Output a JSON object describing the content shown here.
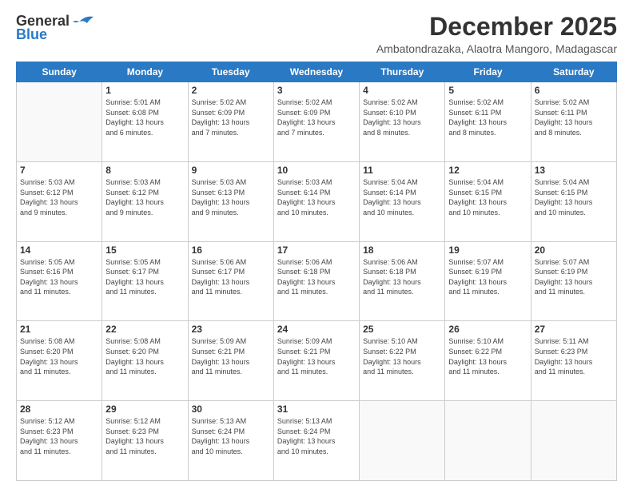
{
  "header": {
    "logo_general": "General",
    "logo_blue": "Blue",
    "month_title": "December 2025",
    "location": "Ambatondrazaka, Alaotra Mangoro, Madagascar"
  },
  "weekdays": [
    "Sunday",
    "Monday",
    "Tuesday",
    "Wednesday",
    "Thursday",
    "Friday",
    "Saturday"
  ],
  "weeks": [
    [
      {
        "day": "",
        "info": ""
      },
      {
        "day": "1",
        "info": "Sunrise: 5:01 AM\nSunset: 6:08 PM\nDaylight: 13 hours\nand 6 minutes."
      },
      {
        "day": "2",
        "info": "Sunrise: 5:02 AM\nSunset: 6:09 PM\nDaylight: 13 hours\nand 7 minutes."
      },
      {
        "day": "3",
        "info": "Sunrise: 5:02 AM\nSunset: 6:09 PM\nDaylight: 13 hours\nand 7 minutes."
      },
      {
        "day": "4",
        "info": "Sunrise: 5:02 AM\nSunset: 6:10 PM\nDaylight: 13 hours\nand 8 minutes."
      },
      {
        "day": "5",
        "info": "Sunrise: 5:02 AM\nSunset: 6:11 PM\nDaylight: 13 hours\nand 8 minutes."
      },
      {
        "day": "6",
        "info": "Sunrise: 5:02 AM\nSunset: 6:11 PM\nDaylight: 13 hours\nand 8 minutes."
      }
    ],
    [
      {
        "day": "7",
        "info": "Sunrise: 5:03 AM\nSunset: 6:12 PM\nDaylight: 13 hours\nand 9 minutes."
      },
      {
        "day": "8",
        "info": "Sunrise: 5:03 AM\nSunset: 6:12 PM\nDaylight: 13 hours\nand 9 minutes."
      },
      {
        "day": "9",
        "info": "Sunrise: 5:03 AM\nSunset: 6:13 PM\nDaylight: 13 hours\nand 9 minutes."
      },
      {
        "day": "10",
        "info": "Sunrise: 5:03 AM\nSunset: 6:14 PM\nDaylight: 13 hours\nand 10 minutes."
      },
      {
        "day": "11",
        "info": "Sunrise: 5:04 AM\nSunset: 6:14 PM\nDaylight: 13 hours\nand 10 minutes."
      },
      {
        "day": "12",
        "info": "Sunrise: 5:04 AM\nSunset: 6:15 PM\nDaylight: 13 hours\nand 10 minutes."
      },
      {
        "day": "13",
        "info": "Sunrise: 5:04 AM\nSunset: 6:15 PM\nDaylight: 13 hours\nand 10 minutes."
      }
    ],
    [
      {
        "day": "14",
        "info": "Sunrise: 5:05 AM\nSunset: 6:16 PM\nDaylight: 13 hours\nand 11 minutes."
      },
      {
        "day": "15",
        "info": "Sunrise: 5:05 AM\nSunset: 6:17 PM\nDaylight: 13 hours\nand 11 minutes."
      },
      {
        "day": "16",
        "info": "Sunrise: 5:06 AM\nSunset: 6:17 PM\nDaylight: 13 hours\nand 11 minutes."
      },
      {
        "day": "17",
        "info": "Sunrise: 5:06 AM\nSunset: 6:18 PM\nDaylight: 13 hours\nand 11 minutes."
      },
      {
        "day": "18",
        "info": "Sunrise: 5:06 AM\nSunset: 6:18 PM\nDaylight: 13 hours\nand 11 minutes."
      },
      {
        "day": "19",
        "info": "Sunrise: 5:07 AM\nSunset: 6:19 PM\nDaylight: 13 hours\nand 11 minutes."
      },
      {
        "day": "20",
        "info": "Sunrise: 5:07 AM\nSunset: 6:19 PM\nDaylight: 13 hours\nand 11 minutes."
      }
    ],
    [
      {
        "day": "21",
        "info": "Sunrise: 5:08 AM\nSunset: 6:20 PM\nDaylight: 13 hours\nand 11 minutes."
      },
      {
        "day": "22",
        "info": "Sunrise: 5:08 AM\nSunset: 6:20 PM\nDaylight: 13 hours\nand 11 minutes."
      },
      {
        "day": "23",
        "info": "Sunrise: 5:09 AM\nSunset: 6:21 PM\nDaylight: 13 hours\nand 11 minutes."
      },
      {
        "day": "24",
        "info": "Sunrise: 5:09 AM\nSunset: 6:21 PM\nDaylight: 13 hours\nand 11 minutes."
      },
      {
        "day": "25",
        "info": "Sunrise: 5:10 AM\nSunset: 6:22 PM\nDaylight: 13 hours\nand 11 minutes."
      },
      {
        "day": "26",
        "info": "Sunrise: 5:10 AM\nSunset: 6:22 PM\nDaylight: 13 hours\nand 11 minutes."
      },
      {
        "day": "27",
        "info": "Sunrise: 5:11 AM\nSunset: 6:23 PM\nDaylight: 13 hours\nand 11 minutes."
      }
    ],
    [
      {
        "day": "28",
        "info": "Sunrise: 5:12 AM\nSunset: 6:23 PM\nDaylight: 13 hours\nand 11 minutes."
      },
      {
        "day": "29",
        "info": "Sunrise: 5:12 AM\nSunset: 6:23 PM\nDaylight: 13 hours\nand 11 minutes."
      },
      {
        "day": "30",
        "info": "Sunrise: 5:13 AM\nSunset: 6:24 PM\nDaylight: 13 hours\nand 10 minutes."
      },
      {
        "day": "31",
        "info": "Sunrise: 5:13 AM\nSunset: 6:24 PM\nDaylight: 13 hours\nand 10 minutes."
      },
      {
        "day": "",
        "info": ""
      },
      {
        "day": "",
        "info": ""
      },
      {
        "day": "",
        "info": ""
      }
    ]
  ]
}
